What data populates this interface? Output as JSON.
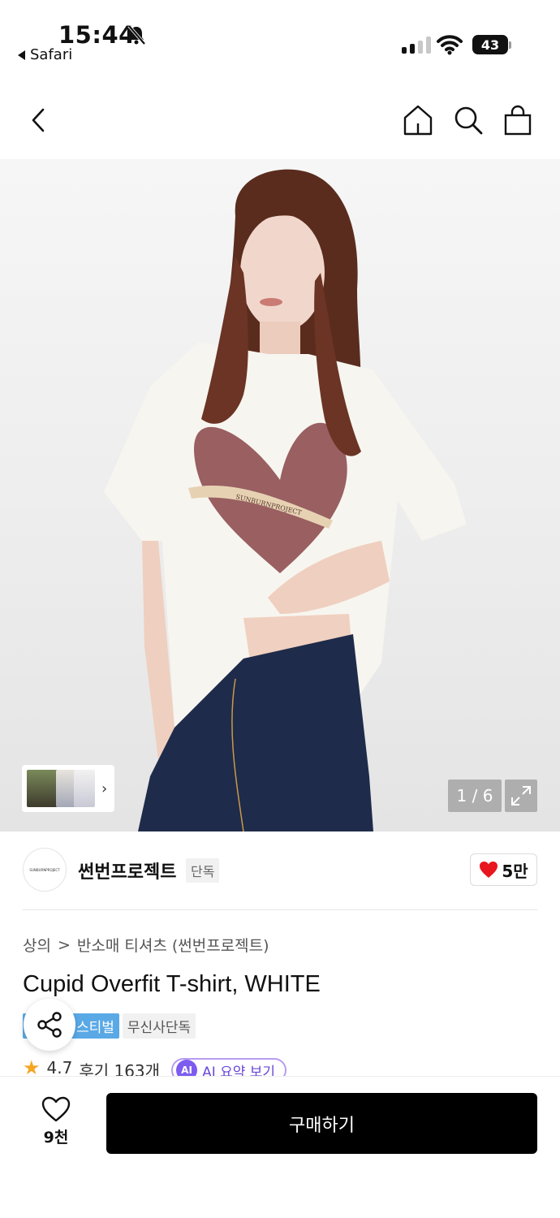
{
  "status_bar": {
    "time": "15:44",
    "back_app": "Safari",
    "battery": "43"
  },
  "hero": {
    "page_indicator": "1 / 6",
    "image_text": "SUNBURNPROJECT"
  },
  "brand": {
    "logo_text": "SUNBURNPROJECT",
    "name": "썬번프로젝트",
    "exclusive_tag": "단독",
    "likes": "5만"
  },
  "breadcrumb": {
    "category": "상의",
    "separator": ">",
    "subcategory": "반소매 티셔츠 (썬번프로젝트)"
  },
  "product": {
    "title": "Cupid Overfit T-shirt, WHITE",
    "tags": [
      "페스티벌",
      "무신사단독"
    ],
    "tag_festival_visible": "스티벌",
    "rating": "4.7",
    "reviews": "후기 163개",
    "ai_badge": "AI",
    "ai_summary": "AI 요약 보기"
  },
  "bottom_bar": {
    "wish_count": "9천",
    "buy_label": "구매하기"
  },
  "colors": {
    "accent_blue": "#5aa9e6",
    "heart_red": "#e8161e",
    "ai_purple": "#7d5cf0",
    "star_orange": "#f5a623"
  }
}
